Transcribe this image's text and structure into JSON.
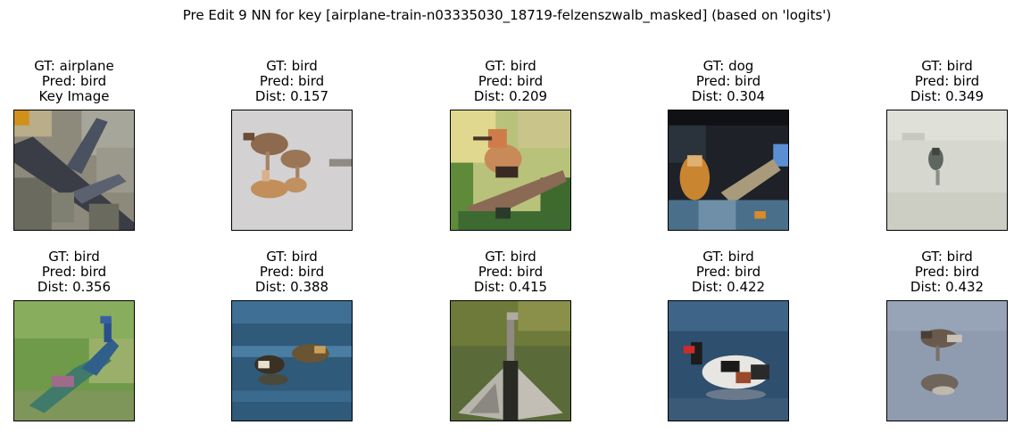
{
  "figure": {
    "suptitle": "Pre Edit 9 NN for key [airplane-train-n03335030_18719-felzenszwalb_masked] (based on 'logits')"
  },
  "panels": [
    {
      "gt": "GT: airplane",
      "pred": "Pred: bird",
      "info": "Key Image",
      "icon": "airplane-photo-thumbnail"
    },
    {
      "gt": "GT: bird",
      "pred": "Pred: bird",
      "info": "Dist: 0.157",
      "icon": "shorebirds-photo-thumbnail"
    },
    {
      "gt": "GT: bird",
      "pred": "Pred: bird",
      "info": "Dist: 0.209",
      "icon": "hoopoe-photo-thumbnail"
    },
    {
      "gt": "GT: dog",
      "pred": "Pred: bird",
      "info": "Dist: 0.304",
      "icon": "dog-photo-thumbnail"
    },
    {
      "gt": "GT: bird",
      "pred": "Pred: bird",
      "info": "Dist: 0.349",
      "icon": "small-bird-photo-thumbnail"
    },
    {
      "gt": "GT: bird",
      "pred": "Pred: bird",
      "info": "Dist: 0.356",
      "icon": "peacock-photo-thumbnail"
    },
    {
      "gt": "GT: bird",
      "pred": "Pred: bird",
      "info": "Dist: 0.388",
      "icon": "ducks-photo-thumbnail"
    },
    {
      "gt": "GT: bird",
      "pred": "Pred: bird",
      "info": "Dist: 0.415",
      "icon": "cormorant-photo-thumbnail"
    },
    {
      "gt": "GT: bird",
      "pred": "Pred: bird",
      "info": "Dist: 0.422",
      "icon": "shelduck-photo-thumbnail"
    },
    {
      "gt": "GT: bird",
      "pred": "Pred: bird",
      "info": "Dist: 0.432",
      "icon": "wader-photo-thumbnail"
    }
  ]
}
